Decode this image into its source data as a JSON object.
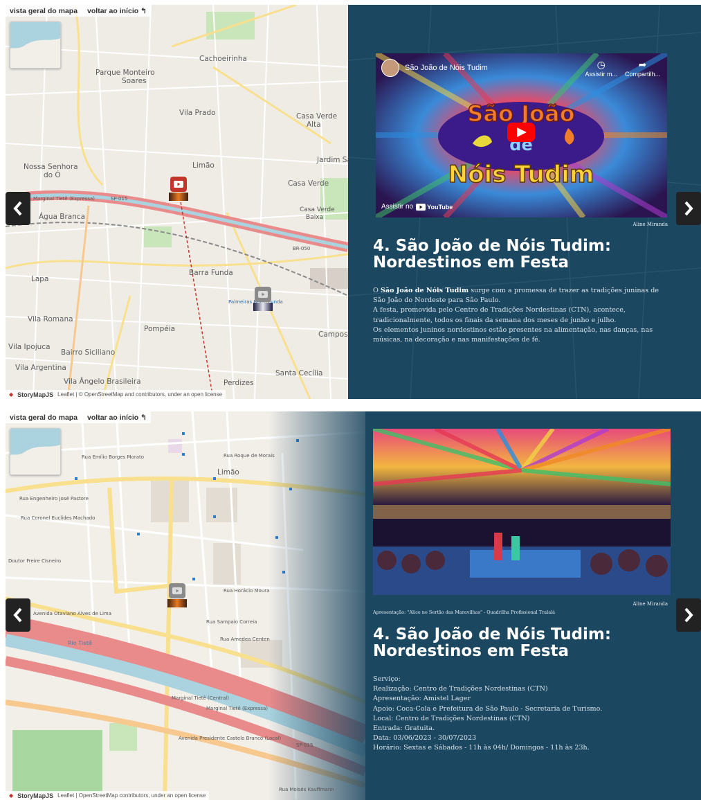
{
  "map_nav": {
    "overview_label": "vista geral do mapa",
    "home_label": "voltar ao início ↰"
  },
  "attribution": {
    "brand": "StoryMapJS",
    "text_1": "Leaflet | © OpenStreetMap and contributors, under an open license",
    "text_2": "Leaflet | OpenStreetMap contributors, under an open license"
  },
  "icons": {
    "prev": "chevron-left-icon",
    "next": "chevron-right-icon",
    "play": "youtube-play-icon",
    "watch_later": "clock-icon",
    "share": "share-icon"
  },
  "colors": {
    "story_bg": "#1c4761",
    "highway": "#e98b8b",
    "primary_road": "#f8e08e",
    "secondary_road": "#ffffff",
    "river": "#aad3df",
    "park": "#c8e6b9",
    "marker_active": "#c2352b",
    "marker_inactive": "#8a8a8a"
  },
  "slide1": {
    "map_labels": {
      "cachoeirinha": "Cachoeirinha",
      "parque_monteiro": "Parque Monteiro",
      "soares": "Soares",
      "vila_prado": "Vila Prado",
      "casa_verde_alta_1": "Casa Verde",
      "casa_verde_alta_2": "Alta",
      "nossa_senhora_1": "Nossa Senhora",
      "nossa_senhora_2": "do Ó",
      "limao": "Limão",
      "jardim_sao_bento": "Jardim São Bento",
      "casa_verde": "Casa Verde",
      "casa_verde_baixa_1": "Casa Verde",
      "casa_verde_baixa_2": "Baixa",
      "agua_branca": "Água Branca",
      "lapa": "Lapa",
      "barra_funda": "Barra Funda",
      "vila_romana": "Vila Romana",
      "pompeia": "Pompéia",
      "vila_ipojuca": "Vila Ipojuca",
      "bairro_siciliano": "Bairro Siciliano",
      "vila_argentina": "Vila Argentina",
      "vila_angelo": "Vila Ângelo Brasileira",
      "santa_cecilia": "Santa Cecília",
      "campos": "Campos",
      "perdizes": "Perdizes",
      "marginal_tiete": "Marginal Tietê (Expressa)",
      "sp015": "SP-015",
      "br050": "BR-050",
      "palmeiras": "Palmeiras Barra Funda"
    },
    "video": {
      "channel_title": "São João de Nóis Tudim",
      "watch_later": "Assistir m...",
      "share": "Compartilh...",
      "logo_line1": "São João",
      "logo_line2": "de",
      "logo_line3": "Nóis Tudim",
      "watch_on": "Assistir no",
      "youtube": "YouTube"
    },
    "credit": "Aline Miranda",
    "title_line1": "4. São João de Nóis Tudim:",
    "title_line2": "Nordestinos em Festa",
    "body": {
      "p1_prefix": "O ",
      "p1_bold": "São João de Nóis Tudim",
      "p1_rest": " surge com a promessa de trazer as tradições juninas de São João do Nordeste para São Paulo.",
      "p2": "A festa, promovida pelo Centro de Tradições Nordestinas (CTN), acontece, tradicionalmente, todos os finais da semana dos meses de junho e julho.",
      "p3": "Os elementos juninos nordestinos estão presentes na alimentação, nas danças, nas músicas, na decoração e nas manifestações de fé."
    }
  },
  "slide2": {
    "map_labels": {
      "limao": "Limão",
      "rua_roque": "Rua Roque de Morais",
      "rua_emilio": "Rua Emílio Borges Morato",
      "rua_engenheiro": "Rua Engenheiro José Pastore",
      "rua_conrad": "Rua Coronel Euclides Machado",
      "rua_carlos": "Rua Carlos Porto Carreiro",
      "rua_doutor": "Doutor Freire Cisneiro",
      "rua_manuel": "Rua Manuel Pinto de Carvalho",
      "rua_gabriel": "Rua Mestre Gabriel Mignon",
      "rua_jacofer": "Rua Jacofer",
      "rua_horacio": "Rua Horácio Moura",
      "rua_sampaio": "Rua Sampaio Correia",
      "rua_almeida": "Rua Amedea Centen",
      "avenida_ordem": "Avenida Otaviano Alves de Lima",
      "marginal_central": "Marginal Tietê (Central)",
      "marginal_expressa": "Marginal Tietê (Expressa)",
      "avenida_presidente": "Avenida Presidente Castelo Branco (Local)",
      "rio_tiete": "Rio Tietê",
      "sp015": "SP-015",
      "rua_moises": "Rua Moisés Kauffmann"
    },
    "credit": "Aline Miranda",
    "caption": "Apresentação: \"Alice no Sertão das Maravilhas\" - Quadrilha Profissional Tralalá",
    "title_line1": "4. São João de Nóis Tudim:",
    "title_line2": "Nordestinos em Festa",
    "service": [
      "Serviço:",
      "Realização:  Centro de Tradições Nordestinas (CTN)",
      "Apresentação:  Amistel Lager",
      "Apoio: Coca-Cola e Prefeitura de São Paulo -  Secretaria de Turismo.",
      "Local:  Centro de Tradições Nordestinas (CTN)",
      "Entrada: Gratuita.",
      "Data: 03/06/2023 - 30/07/2023",
      "Horário: Sextas e Sábados -  11h às 04h/ Domingos -  11h às 23h."
    ]
  }
}
